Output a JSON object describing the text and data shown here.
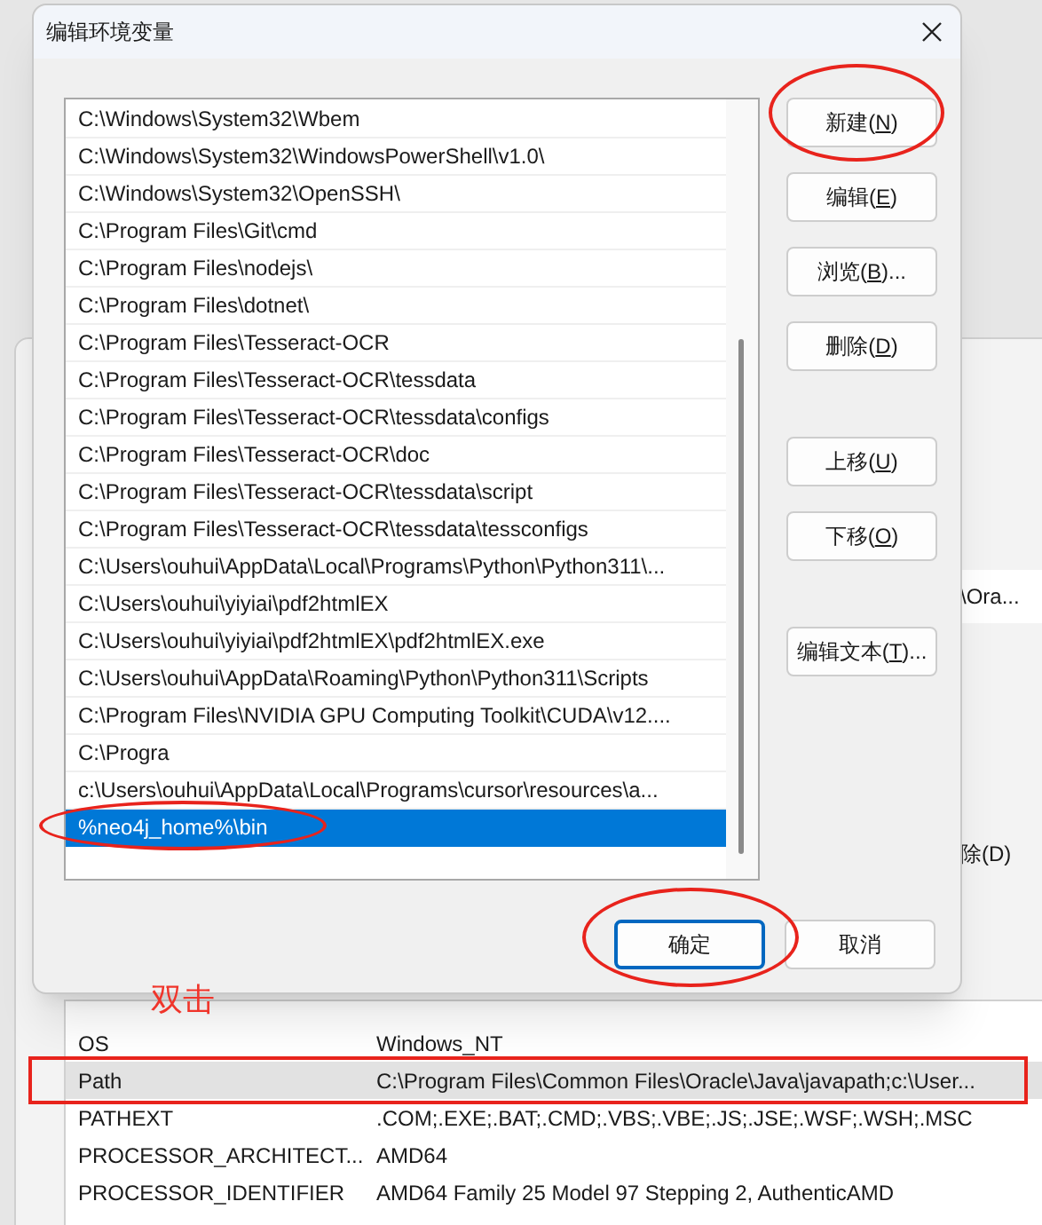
{
  "dialog": {
    "title": "编辑环境变量",
    "paths": [
      {
        "text": "C:\\Windows\\System32\\Wbem",
        "selected": false
      },
      {
        "text": "C:\\Windows\\System32\\WindowsPowerShell\\v1.0\\",
        "selected": false
      },
      {
        "text": "C:\\Windows\\System32\\OpenSSH\\",
        "selected": false
      },
      {
        "text": "C:\\Program Files\\Git\\cmd",
        "selected": false
      },
      {
        "text": "C:\\Program Files\\nodejs\\",
        "selected": false
      },
      {
        "text": "C:\\Program Files\\dotnet\\",
        "selected": false
      },
      {
        "text": "C:\\Program Files\\Tesseract-OCR",
        "selected": false
      },
      {
        "text": "C:\\Program Files\\Tesseract-OCR\\tessdata",
        "selected": false
      },
      {
        "text": "C:\\Program Files\\Tesseract-OCR\\tessdata\\configs",
        "selected": false
      },
      {
        "text": "C:\\Program Files\\Tesseract-OCR\\doc",
        "selected": false
      },
      {
        "text": "C:\\Program Files\\Tesseract-OCR\\tessdata\\script",
        "selected": false
      },
      {
        "text": "C:\\Program Files\\Tesseract-OCR\\tessdata\\tessconfigs",
        "selected": false
      },
      {
        "text": "C:\\Users\\ouhui\\AppData\\Local\\Programs\\Python\\Python311\\...",
        "selected": false
      },
      {
        "text": "C:\\Users\\ouhui\\yiyiai\\pdf2htmlEX",
        "selected": false
      },
      {
        "text": "C:\\Users\\ouhui\\yiyiai\\pdf2htmlEX\\pdf2htmlEX.exe",
        "selected": false
      },
      {
        "text": "C:\\Users\\ouhui\\AppData\\Roaming\\Python\\Python311\\Scripts",
        "selected": false
      },
      {
        "text": "C:\\Program Files\\NVIDIA GPU Computing Toolkit\\CUDA\\v12....",
        "selected": false
      },
      {
        "text": "C:\\Progra",
        "selected": false
      },
      {
        "text": "c:\\Users\\ouhui\\AppData\\Local\\Programs\\cursor\\resources\\a...",
        "selected": false
      },
      {
        "text": "%neo4j_home%\\bin",
        "selected": true
      }
    ],
    "side_buttons": [
      {
        "pre": "新建(",
        "key": "N",
        "post": ")"
      },
      {
        "pre": "编辑(",
        "key": "E",
        "post": ")"
      },
      {
        "pre": "浏览(",
        "key": "B",
        "post": ")..."
      },
      {
        "pre": "删除(",
        "key": "D",
        "post": ")"
      },
      {
        "pre": "上移(",
        "key": "U",
        "post": ")"
      },
      {
        "pre": "下移(",
        "key": "O",
        "post": ")"
      },
      {
        "pre": "编辑文本(",
        "key": "T",
        "post": ")..."
      }
    ],
    "footer_buttons": [
      {
        "text": "确定",
        "default": true
      },
      {
        "text": "取消",
        "default": false
      }
    ]
  },
  "background_window": {
    "fragments": [
      "\\Ora...",
      "除(D)"
    ],
    "rows": [
      {
        "name": "OS",
        "value": "Windows_NT",
        "selected": false
      },
      {
        "name": "Path",
        "value": "C:\\Program Files\\Common Files\\Oracle\\Java\\javapath;c:\\User...",
        "selected": true
      },
      {
        "name": "PATHEXT",
        "value": ".COM;.EXE;.BAT;.CMD;.VBS;.VBE;.JS;.JSE;.WSF;.WSH;.MSC",
        "selected": false
      },
      {
        "name": "PROCESSOR_ARCHITECT...",
        "value": "AMD64",
        "selected": false
      },
      {
        "name": "PROCESSOR_IDENTIFIER",
        "value": "AMD64 Family 25 Model 97 Stepping 2, AuthenticAMD",
        "selected": false
      }
    ]
  },
  "annotation": {
    "text": "双击"
  }
}
